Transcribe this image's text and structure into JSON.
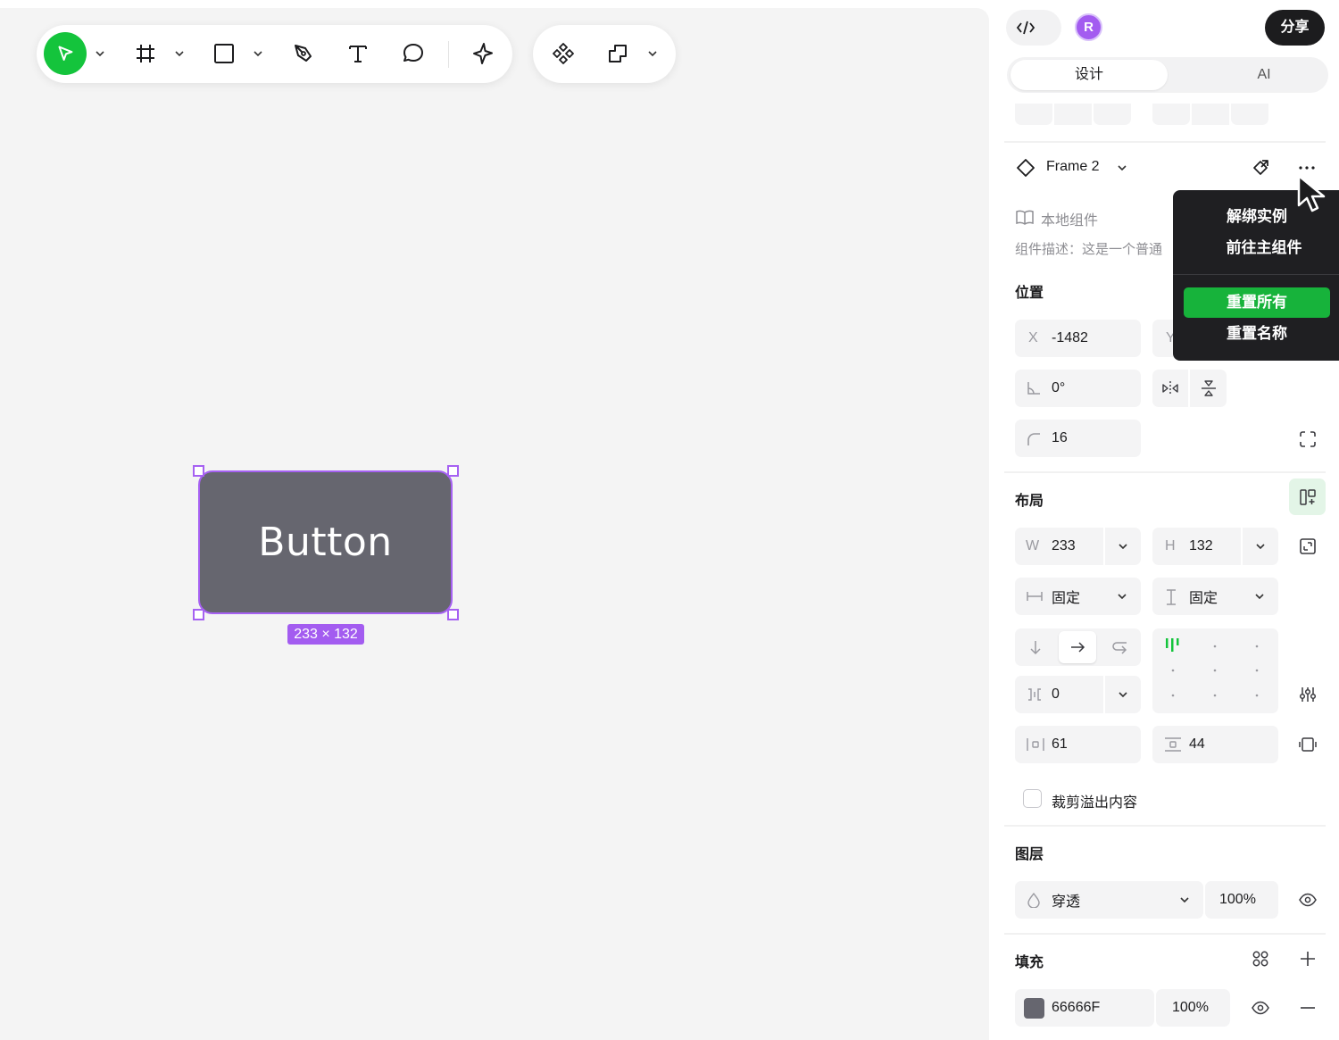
{
  "toolbar": {
    "tools": [
      {
        "name": "move-tool",
        "icon": "cursor-arrow-icon"
      },
      {
        "name": "frame-tool",
        "icon": "hash-frame-icon"
      },
      {
        "name": "rectangle-tool",
        "icon": "square-icon"
      },
      {
        "name": "pen-tool",
        "icon": "pen-icon"
      },
      {
        "name": "text-tool",
        "icon": "text-t-icon"
      },
      {
        "name": "comment-tool",
        "icon": "speech-bubble-icon"
      },
      {
        "name": "ai-tool",
        "icon": "sparkle-icon"
      }
    ],
    "component_tools": [
      {
        "name": "component-tool",
        "icon": "component-diamonds-icon"
      },
      {
        "name": "boolean-tool",
        "icon": "boolean-shape-icon"
      }
    ],
    "accent": "#14c43c"
  },
  "canvas": {
    "frame_text": "Button",
    "frame_fill": "#66666f",
    "selection_color": "#a661f2",
    "size_badge": "233 × 132"
  },
  "header": {
    "avatar_initial": "R",
    "share_label": "分享"
  },
  "tabs": {
    "design": "设计",
    "ai": "AI"
  },
  "component": {
    "name": "Frame 2",
    "library": "本地组件",
    "description": "组件描述：这是一个普通"
  },
  "context_menu": {
    "items": [
      "解绑实例",
      "前往主组件",
      "重置所有",
      "重置名称"
    ],
    "highlight_color": "#17b33b"
  },
  "position": {
    "title": "位置",
    "x_label": "X",
    "x_value": "-1482",
    "y_label": "Y",
    "rotation": "0°",
    "radius": "16"
  },
  "layout": {
    "title": "布局",
    "w_label": "W",
    "w_value": "233",
    "h_label": "H",
    "h_value": "132",
    "width_mode": "固定",
    "height_mode": "固定",
    "gap": "0",
    "padding_h": "61",
    "padding_v": "44",
    "clip_label": "裁剪溢出内容"
  },
  "layer": {
    "title": "图层",
    "blend": "穿透",
    "opacity": "100%"
  },
  "fill": {
    "title": "填充",
    "hex": "66666F",
    "opacity": "100%",
    "swatch": "#66666f"
  }
}
